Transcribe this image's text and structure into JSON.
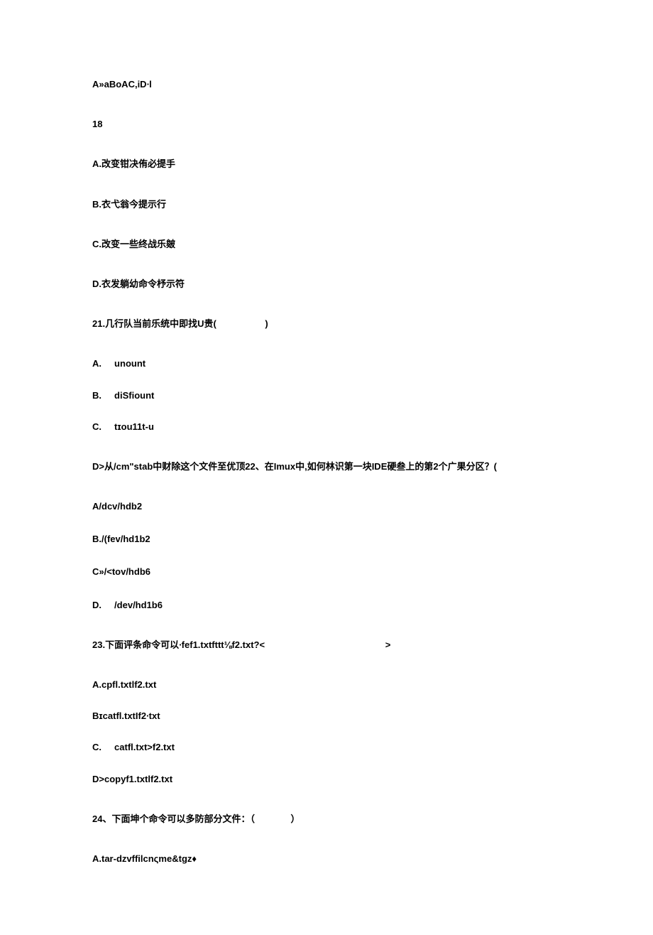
{
  "lines": {
    "l01": "A»aBoAC,iD∙l",
    "l02": "18",
    "l03": "A.改变钳决侑必提手",
    "l04": "B.衣弋翁今提示行",
    "l05": "C.改变一些终战乐皴",
    "l06": "D.衣发躺幼命令杼示符",
    "l07": "21.几行队当前乐统中即找U贵(                   )",
    "l08": "A.     unount",
    "l09": "B.     diSfiount",
    "l10": "C.     tɪou11t-u",
    "l11": "D>从/cm\"stab中财除这个文件至优顶22、在Imux中,如何林识第一块IDE硬叁上的第2个广果分区？(",
    "l12": "A/dcv/hdb2",
    "l13": "B./(fev/hd1b2",
    "l14": "C»/<tov/hdb6",
    "l15": "D.     /dev/hd1b6",
    "l16": "23.下面评条命令可以∙fef1.txtfttt⅛f2.txt?<                                               >",
    "l17": "A.cpfl.txtlf2.txt",
    "l18": "Bɪcatfl.txtIf2∙txt",
    "l19": "C.     catfl.txt>f2.txt",
    "l20": "D>copyf1.txtlf2.txt",
    "l21": "24、下面坤个命令可以多防部分文件：（              ）",
    "l22": "A.tar-dzvffilcnςme&tgz♦"
  }
}
